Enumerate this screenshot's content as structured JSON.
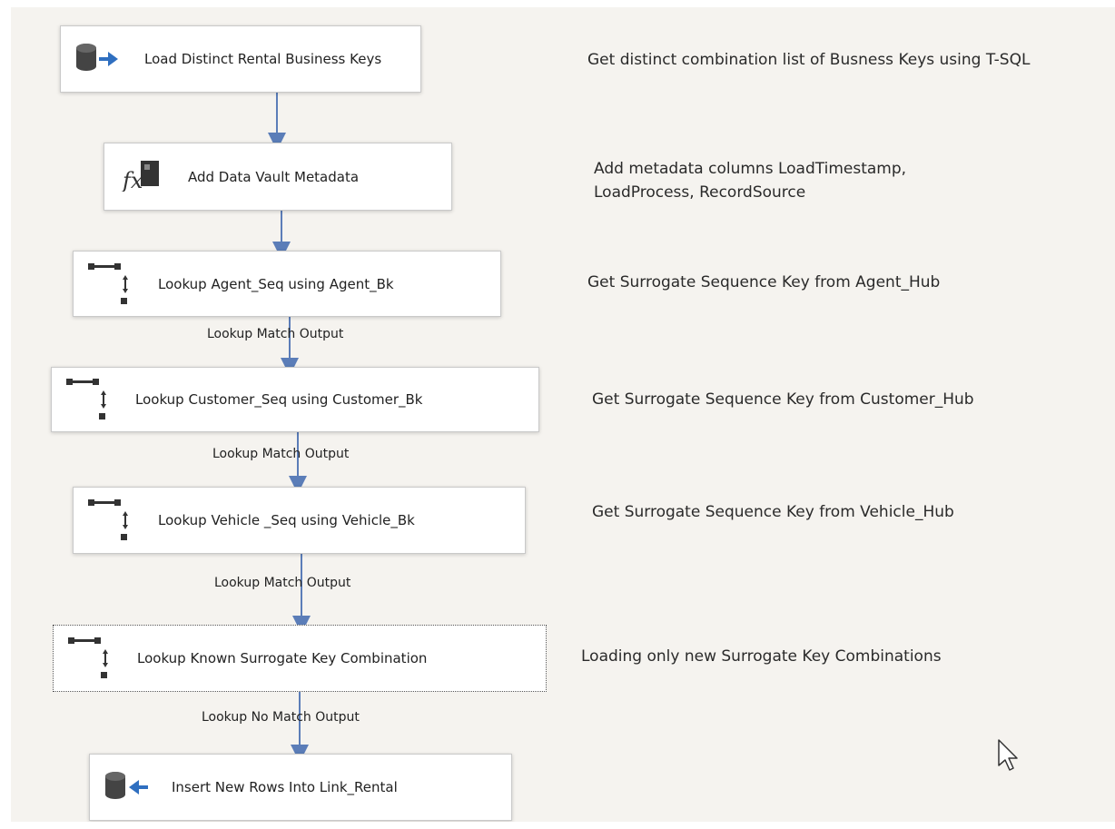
{
  "tasks": [
    {
      "label": "Load Distinct Rental Business Keys",
      "icon": "database-source-icon"
    },
    {
      "label": "Add Data Vault Metadata",
      "icon": "derived-column-fx-icon"
    },
    {
      "label": "Lookup Agent_Seq using Agent_Bk",
      "icon": "lookup-icon"
    },
    {
      "label": "Lookup Customer_Seq using Customer_Bk",
      "icon": "lookup-icon"
    },
    {
      "label": "Lookup Vehicle _Seq using Vehicle_Bk",
      "icon": "lookup-icon"
    },
    {
      "label": "Lookup Known Surrogate Key Combination",
      "icon": "lookup-icon",
      "selected": true
    },
    {
      "label": "Insert New Rows Into Link_Rental",
      "icon": "database-destination-icon"
    }
  ],
  "paths": [
    {
      "label": ""
    },
    {
      "label": ""
    },
    {
      "label": "Lookup Match Output"
    },
    {
      "label": "Lookup Match Output"
    },
    {
      "label": "Lookup Match Output"
    },
    {
      "label": "Lookup No Match Output"
    }
  ],
  "notes": [
    "Get distinct combination list of Busness Keys using T-SQL",
    "Add metadata columns LoadTimestamp,",
    "LoadProcess, RecordSource",
    "Get Surrogate Sequence Key from Agent_Hub",
    "Get Surrogate Sequence Key from Customer_Hub",
    "Get Surrogate Sequence Key from Vehicle_Hub",
    "Loading only new Surrogate Key Combinations"
  ],
  "colors": {
    "canvas": "#f5f3ef",
    "connector": "#5b7db8",
    "arrow_blue": "#2f6fc0"
  }
}
